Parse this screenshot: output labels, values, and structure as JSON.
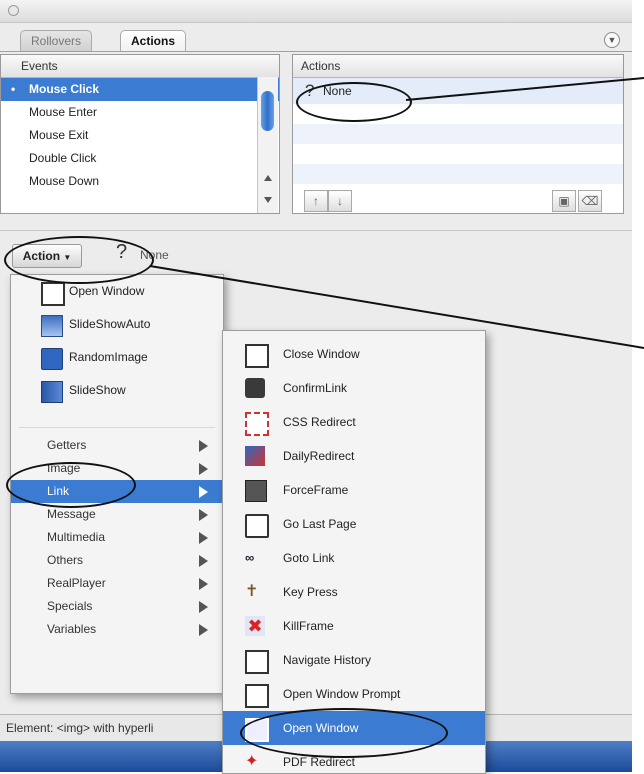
{
  "tabs": {
    "rollovers": "Rollovers",
    "actions": "Actions"
  },
  "events": {
    "header": "Events",
    "items": [
      "Mouse Click",
      "Mouse Enter",
      "Mouse Exit",
      "Double Click",
      "Mouse Down"
    ],
    "selected": "Mouse Click"
  },
  "actions_panel": {
    "header": "Actions",
    "items": [
      {
        "icon": "question-icon",
        "label": "None"
      }
    ]
  },
  "toolbar": {
    "action_button": "Action",
    "question_glyph": "?",
    "none_label": "None"
  },
  "action_menu": {
    "items": [
      {
        "icon": "window-icon",
        "label": "Open Window"
      },
      {
        "icon": "slideshow-auto-icon",
        "label": "SlideShowAuto"
      },
      {
        "icon": "random-image-icon",
        "label": "RandomImage"
      },
      {
        "icon": "slideshow-icon",
        "label": "SlideShow"
      }
    ],
    "categories": [
      "Getters",
      "Image",
      "Link",
      "Message",
      "Multimedia",
      "Others",
      "RealPlayer",
      "Specials",
      "Variables"
    ],
    "selected_category": "Link"
  },
  "link_submenu": {
    "items": [
      {
        "icon": "close-window-icon",
        "label": "Close Window"
      },
      {
        "icon": "confirm-link-icon",
        "label": "ConfirmLink"
      },
      {
        "icon": "css-redirect-icon",
        "label": "CSS Redirect"
      },
      {
        "icon": "daily-redirect-icon",
        "label": "DailyRedirect"
      },
      {
        "icon": "force-frame-icon",
        "label": "ForceFrame"
      },
      {
        "icon": "go-last-page-icon",
        "label": "Go Last Page"
      },
      {
        "icon": "goto-link-icon",
        "label": "Goto Link"
      },
      {
        "icon": "key-press-icon",
        "label": "Key Press"
      },
      {
        "icon": "kill-frame-icon",
        "label": "KillFrame"
      },
      {
        "icon": "navigate-history-icon",
        "label": "Navigate History"
      },
      {
        "icon": "open-window-prompt-icon",
        "label": "Open Window Prompt"
      },
      {
        "icon": "open-window-icon",
        "label": "Open Window"
      },
      {
        "icon": "pdf-redirect-icon",
        "label": "PDF Redirect"
      }
    ],
    "selected": "Open Window"
  },
  "status_bar": {
    "text": "Element: <img> with hyperli"
  },
  "colors": {
    "selection": "#3b7bd2",
    "panel_bg": "#ececec",
    "callout": "#111111"
  }
}
